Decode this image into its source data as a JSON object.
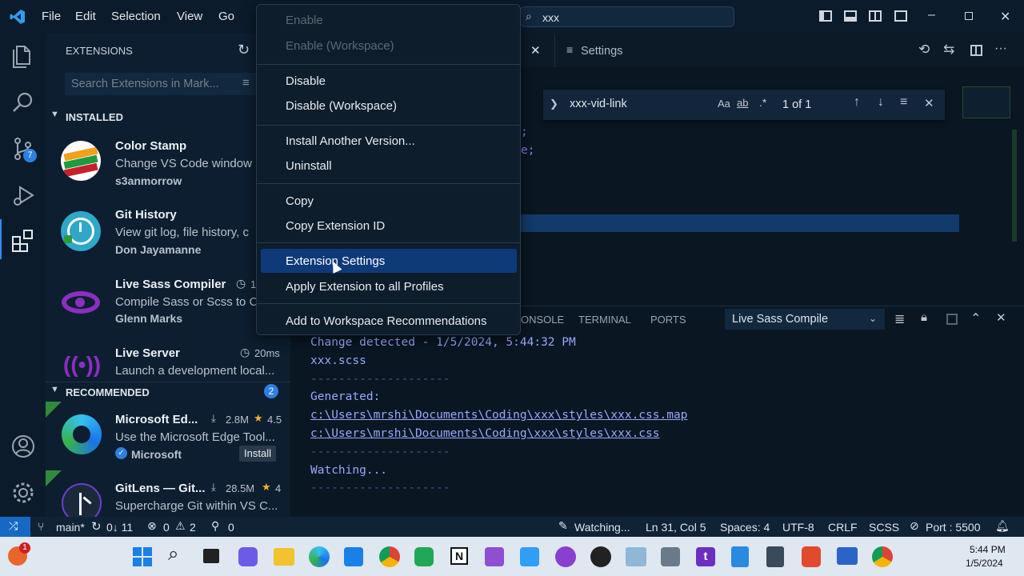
{
  "menubar": {
    "file": "File",
    "edit": "Edit",
    "selection": "Selection",
    "view": "View",
    "go": "Go",
    "more": "…"
  },
  "search": {
    "value": "xxx"
  },
  "sidebar": {
    "title": "EXTENSIONS",
    "search_placeholder": "Search Extensions in Mark...",
    "installed_label": "INSTALLED",
    "recommended_label": "RECOMMENDED",
    "recommended_count": "2",
    "installed": [
      {
        "name": "Color Stamp",
        "desc": "Change VS Code window",
        "author": "s3anmorrow"
      },
      {
        "name": "Git History",
        "desc": "View git log, file history, c",
        "author": "Don Jayamanne"
      },
      {
        "name": "Live Sass Compiler",
        "desc": "Compile Sass or Scss to C",
        "author": "Glenn Marks",
        "time": "1"
      },
      {
        "name": "Live Server",
        "desc": "Launch a development local...",
        "time": "20ms"
      }
    ],
    "recommended": [
      {
        "name": "Microsoft Ed...",
        "downloads": "2.8M",
        "rating": "4.5",
        "desc": "Use the Microsoft Edge Tool...",
        "author": "Microsoft",
        "install": "Install"
      },
      {
        "name": "GitLens — Git...",
        "downloads": "28.5M",
        "rating": "4",
        "desc": "Supercharge Git within VS C..."
      }
    ]
  },
  "activity": {
    "scm_badge": "7"
  },
  "editor": {
    "tab_settings": "Settings",
    "find_value": "xxx-vid-link",
    "find_case": "Aa",
    "find_word": "ab",
    "find_regex": ".*",
    "find_result": "1 of 1",
    "code_line1": ";",
    "code_line2": "e;"
  },
  "panel": {
    "tabs": {
      "console": "ONSOLE",
      "terminal": "TERMINAL",
      "ports": "PORTS"
    },
    "dropdown": "Live Sass Compile",
    "lines": [
      "Change detected - 1/5/2024, 5:44:32 PM",
      "xxx.scss",
      "--------------------",
      "Generated:",
      "c:\\Users\\mrshi\\Documents\\Coding\\xxx\\styles\\xxx.css.map",
      "c:\\Users\\mrshi\\Documents\\Coding\\xxx\\styles\\xxx.css",
      "--------------------",
      "Watching...",
      "--------------------"
    ]
  },
  "context_menu": {
    "enable": "Enable",
    "enable_ws": "Enable (Workspace)",
    "disable": "Disable",
    "disable_ws": "Disable (Workspace)",
    "install_other": "Install Another Version...",
    "uninstall": "Uninstall",
    "copy": "Copy",
    "copy_id": "Copy Extension ID",
    "ext_settings": "Extension Settings",
    "apply_all": "Apply Extension to all Profiles",
    "add_ws_rec": "Add to Workspace Recommendations"
  },
  "status": {
    "branch": "main*",
    "sync": "0↓ 11",
    "errors": "0",
    "warnings": "2",
    "ports": "0",
    "watching": "Watching...",
    "position": "Ln 31, Col 5",
    "spaces": "Spaces: 4",
    "encoding": "UTF-8",
    "eol": "CRLF",
    "language": "SCSS",
    "port": "Port : 5500"
  },
  "taskbar": {
    "time": "5:44 PM",
    "date": "1/5/2024",
    "badge": "1"
  },
  "colors": {
    "accent": "#0e3a7a",
    "link": "#6aa6ff",
    "terminal_text": "#9aa7ff"
  }
}
